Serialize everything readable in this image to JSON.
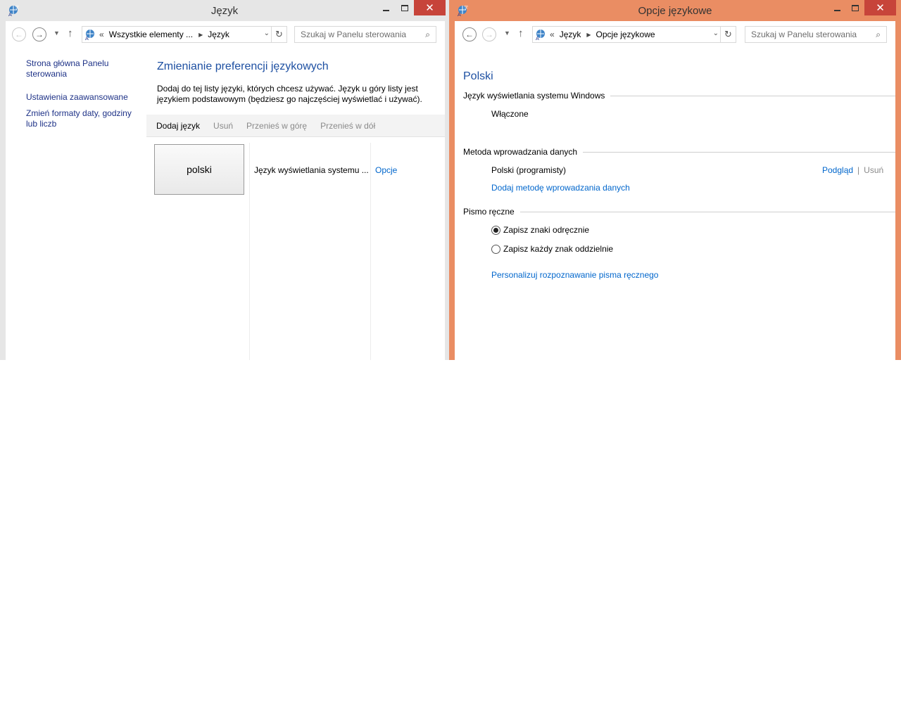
{
  "left_window": {
    "title": "Język",
    "breadcrumb": {
      "prefix": "«",
      "items": [
        "Wszystkie elementy ...",
        "Język"
      ]
    },
    "search_placeholder": "Szukaj w Panelu sterowania",
    "sidebar": {
      "links": [
        "Strona główna Panelu sterowania",
        "Ustawienia zaawansowane",
        "Zmień formaty daty, godziny lub liczb"
      ]
    },
    "heading": "Zmienianie preferencji językowych",
    "description": "Dodaj do tej listy języki, których chcesz używać. Język u góry listy jest językiem podstawowym (będziesz go najczęściej wyświetlać i używać).",
    "toolbar": {
      "add": "Dodaj język",
      "remove": "Usuń",
      "move_up": "Przenieś w górę",
      "move_down": "Przenieś w dół"
    },
    "language_item": {
      "name": "polski",
      "info": "Język wyświetlania systemu ...",
      "options": "Opcje"
    }
  },
  "right_window": {
    "title": "Opcje językowe",
    "breadcrumb": {
      "prefix": "«",
      "items": [
        "Język",
        "Opcje językowe"
      ]
    },
    "search_placeholder": "Szukaj w Panelu sterowania",
    "heading": "Polski",
    "display_language": {
      "label": "Język wyświetlania systemu Windows",
      "status": "Włączone"
    },
    "input_method": {
      "label": "Metoda wprowadzania danych",
      "item": "Polski (programisty)",
      "preview": "Podgląd",
      "separator": "|",
      "remove": "Usuń",
      "add_link": "Dodaj metodę wprowadzania danych"
    },
    "handwriting": {
      "label": "Pismo ręczne",
      "options": [
        {
          "label": "Zapisz znaki odręcznie",
          "selected": true
        },
        {
          "label": "Zapisz każdy znak oddzielnie",
          "selected": false
        }
      ],
      "personalize_link": "Personalizuj rozpoznawanie pisma ręcznego"
    }
  },
  "colors": {
    "active_frame": "#ea8d63",
    "inactive_frame": "#e6e6e6",
    "close_button": "#c7443a",
    "heading": "#1e50a2",
    "link": "#0066cc"
  }
}
